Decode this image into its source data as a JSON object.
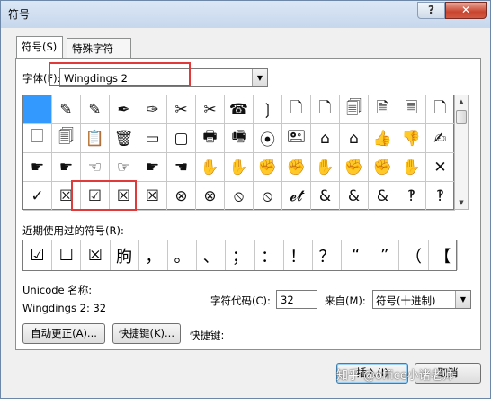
{
  "window": {
    "title": "符号",
    "help_label": "?",
    "close_label": "✕"
  },
  "tabs": [
    {
      "label": "符号(S)"
    },
    {
      "label": "特殊字符(P)"
    }
  ],
  "font": {
    "label": "字体(F):",
    "value": "Wingdings 2"
  },
  "grid": [
    [
      "",
      "✎",
      "✎",
      "✒",
      "✑",
      "✂",
      "✂",
      "☎",
      "❳",
      "🗋",
      "🗋",
      "🗐",
      "🗎",
      "🗏",
      "🗋"
    ],
    [
      "🗌",
      "🗐",
      "📋",
      "🗑",
      "▭",
      "▢",
      "🖶",
      "🖷",
      "⦿",
      "🖭",
      "⌂",
      "⌂",
      "👍",
      "👎",
      "✍"
    ],
    [
      "☛",
      "☛",
      "☜",
      "☞",
      "☛",
      "☚",
      "✋",
      "✋",
      "✊",
      "✊",
      "✋",
      "✊",
      "✊",
      "✋",
      "✕"
    ],
    [
      "✓",
      "☒",
      "☑",
      "☒",
      "☒",
      "⊗",
      "⊗",
      "⦸",
      "⦸",
      "𝓮𝓽",
      "&",
      "&",
      "&",
      "‽",
      "‽"
    ]
  ],
  "recent": {
    "label": "近期使用过的符号(R):",
    "items": [
      "☑",
      "☐",
      "☒",
      "朐",
      "，",
      "。",
      "、",
      "；",
      "：",
      "！",
      "？",
      "“",
      "”",
      "（",
      "【",
      "）"
    ]
  },
  "unicode": {
    "name_label": "Unicode 名称:",
    "source_line": "Wingdings 2: 32"
  },
  "charcode": {
    "label": "字符代码(C):",
    "value": "32"
  },
  "from": {
    "label": "来自(M):",
    "value": "符号(十进制)"
  },
  "buttons": {
    "autocorrect": "自动更正(A)...",
    "shortcut": "快捷键(K)...",
    "shortcut_label": "快捷键:",
    "insert": "插入(I)",
    "cancel": "取消"
  },
  "watermark": "知乎 @office小诸老师",
  "colors": {
    "selection": "#3399ff",
    "highlight": "#e03a3a"
  }
}
